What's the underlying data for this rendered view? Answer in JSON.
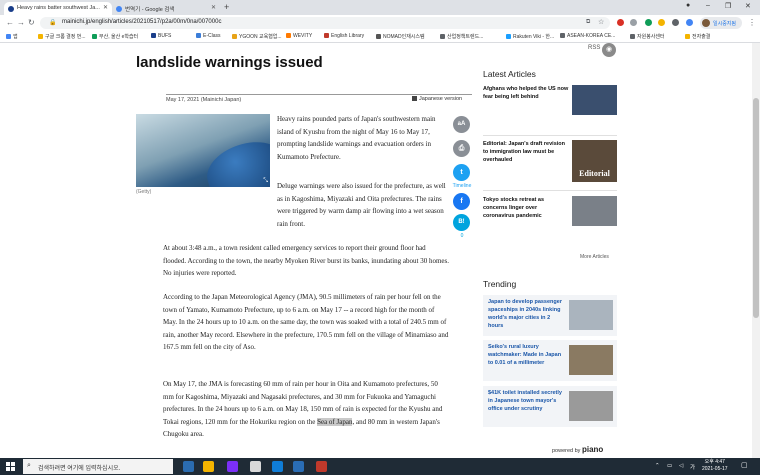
{
  "browser": {
    "tabs": [
      {
        "title": "Heavy rains batter southwest Ja..."
      },
      {
        "title": "번역기 - Google 검색"
      }
    ],
    "new_tab": "+",
    "url": "mainichi.jp/english/articles/20210517/p2a/00m/0na/007000c",
    "profile_label": "일시중지됨"
  },
  "bookmarks": [
    {
      "label": "앱",
      "color": "#4285f4"
    },
    {
      "label": "구글 크롬 결정 번...",
      "color": "#f4b400"
    },
    {
      "label": "부산, 울산 e학습터",
      "color": "#0f9d58"
    },
    {
      "label": "BUFS",
      "color": "#1a3e8a"
    },
    {
      "label": "E-Class",
      "color": "#3b7dd8"
    },
    {
      "label": "YGOON 교육협업...",
      "color": "#e8a317"
    },
    {
      "label": "WEVITY",
      "color": "#ff7a00"
    },
    {
      "label": "English Library",
      "color": "#c0392b"
    },
    {
      "label": "NOMAD인재시스템",
      "color": "#555555"
    },
    {
      "label": "산업정책트렌드...",
      "color": "#5f6368"
    },
    {
      "label": "Rakuten Viki - 한...",
      "color": "#1a9fff"
    },
    {
      "label": "ASEAN-KOREA CE...",
      "color": "#5f6368"
    },
    {
      "label": "자원봉사센터",
      "color": "#5f6368"
    },
    {
      "label": "전자출결",
      "color": "#f4b400"
    }
  ],
  "article": {
    "headline": "landslide warnings issued",
    "date": "May 17, 2021 (Mainichi Japan)",
    "japanese_version": "Japanese version",
    "photo_credit": "(Getty)",
    "paragraphs": [
      "Heavy rains pounded parts of Japan's southwestern main island of Kyushu from the night of May 16 to May 17, prompting landslide warnings and evacuation orders in Kumamoto Prefecture.",
      "Deluge warnings were also issued for the prefecture, as well as in Kagoshima, Miyazaki and Oita prefectures. The rains were triggered by warm damp air flowing into a wet season rain front.",
      "At about 3:48 a.m., a town resident called emergency services to report their ground floor had flooded. According to the town, the nearby Myoken River burst its banks, inundating about 30 homes. No injuries were reported.",
      "According to the Japan Meteorological Agency (JMA), 90.5 millimeters of rain per hour fell on the town of Yamato, Kumamoto Prefecture, up to 6 a.m. on May 17 -- a record high for the month of May. In the 24 hours up to 10 a.m. on the same day, the town was soaked with a total of 240.5 mm of rain, another May record. Elsewhere in the prefecture, 170.5 mm fell on the village of Minamiaso and 167.5 mm fell on the city of Aso.",
      "On May 17, the JMA is forecasting 60 mm of rain per hour in Oita and Kumamoto prefectures, 50 mm for Kagoshima, Miyazaki and Nagasaki prefectures, and 30 mm for Fukuoka and Yamaguchi prefectures. In the 24 hours up to 6 a.m. on May 18, 150 mm of rain is expected for the Kyushu and Tokai regions, 120 mm for the Hokuriku region on the"
    ],
    "highlight": "Sea of Japan",
    "last_tail": ", and 80 mm in western Japan's Chugoku area."
  },
  "share": {
    "font_size": "aA",
    "print": "⎙",
    "twitter_label": "Timeline",
    "hatena": "B!",
    "hatena_count": "0"
  },
  "sidebar": {
    "rss": "RSS",
    "latest_title": "Latest Articles",
    "latest": [
      {
        "title": "Afghans who helped the US now fear being left behind",
        "color": "#3a4f6e"
      },
      {
        "title": "Editorial: Japan's draft revision to immigration law must be overhauled",
        "color": "#5a4a3a",
        "overlay": "Editorial"
      },
      {
        "title": "Tokyo stocks retreat as concerns linger over coronavirus pandemic",
        "color": "#7a8088"
      }
    ],
    "more_articles": "More Articles",
    "trending_title": "Trending",
    "trending": [
      {
        "title": "Japan to develop passenger spaceships in 2040s linking world's major cities in 2 hours",
        "color": "#aab4be"
      },
      {
        "title": "Seiko's rural luxury watchmaker: Made in Japan to 0.01 of a millimeter",
        "color": "#8a7a62"
      },
      {
        "title": "$41K toilet installed secretly in Japanese town mayor's office under scrutiny",
        "color": "#9a9a9a"
      }
    ],
    "powered_by": "powered by",
    "piano": "piano"
  },
  "taskbar": {
    "search_placeholder": "검색하려면 여기에 입력하십시오.",
    "time": "오후 4:47",
    "date": "2021-05-17",
    "apps": [
      "#2b6cb0",
      "#f4b400",
      "#7b2ff7",
      "#d9d9d9",
      "#0f7dd8",
      "#2a6db5",
      "#c0392b"
    ]
  }
}
